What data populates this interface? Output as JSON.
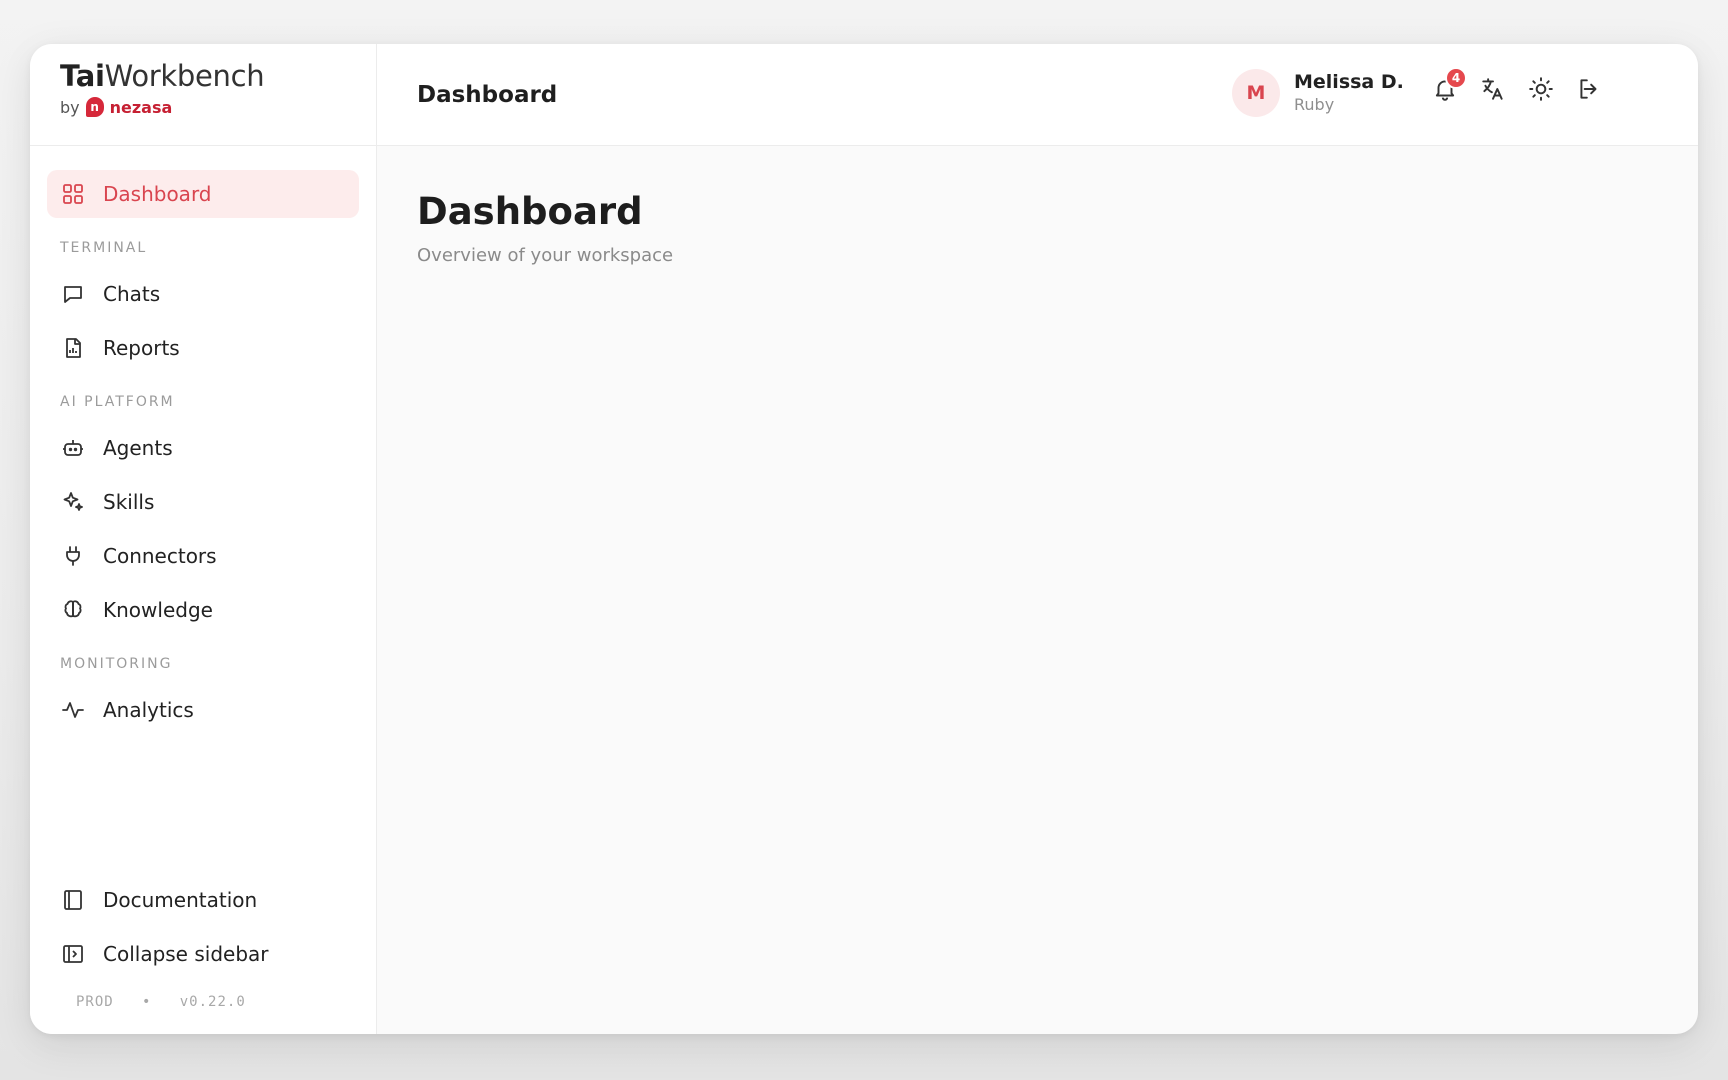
{
  "brand": {
    "title_bold": "Tai",
    "title_light": "Workbench",
    "by_label": "by",
    "logo_letter": "n",
    "company": "nezasa",
    "accent": "#d6283a"
  },
  "sidebar": {
    "top_item": {
      "label": "Dashboard",
      "icon": "grid-icon",
      "active": true
    },
    "sections": [
      {
        "label": "TERMINAL",
        "items": [
          {
            "label": "Chats",
            "icon": "chat-icon"
          },
          {
            "label": "Reports",
            "icon": "report-icon"
          }
        ]
      },
      {
        "label": "AI PLATFORM",
        "items": [
          {
            "label": "Agents",
            "icon": "bot-icon"
          },
          {
            "label": "Skills",
            "icon": "sparkles-icon"
          },
          {
            "label": "Connectors",
            "icon": "plug-icon"
          },
          {
            "label": "Knowledge",
            "icon": "brain-icon"
          }
        ]
      },
      {
        "label": "MONITORING",
        "items": [
          {
            "label": "Analytics",
            "icon": "activity-icon"
          }
        ]
      }
    ],
    "bottom_items": [
      {
        "label": "Documentation",
        "icon": "book-icon"
      },
      {
        "label": "Collapse sidebar",
        "icon": "panel-icon"
      }
    ],
    "footer": {
      "env": "PROD",
      "separator": "•",
      "version": "v0.22.0"
    }
  },
  "topbar": {
    "title": "Dashboard",
    "user": {
      "initial": "M",
      "name": "Melissa D.",
      "role": "Ruby"
    },
    "notifications_count": "4",
    "icons": [
      "bell-icon",
      "translate-icon",
      "sun-icon",
      "logout-icon"
    ]
  },
  "content": {
    "title": "Dashboard",
    "subtitle": "Overview of your workspace"
  },
  "colors": {
    "active_bg": "#fdecec",
    "active_text": "#d9454f",
    "badge": "#e5484d"
  }
}
